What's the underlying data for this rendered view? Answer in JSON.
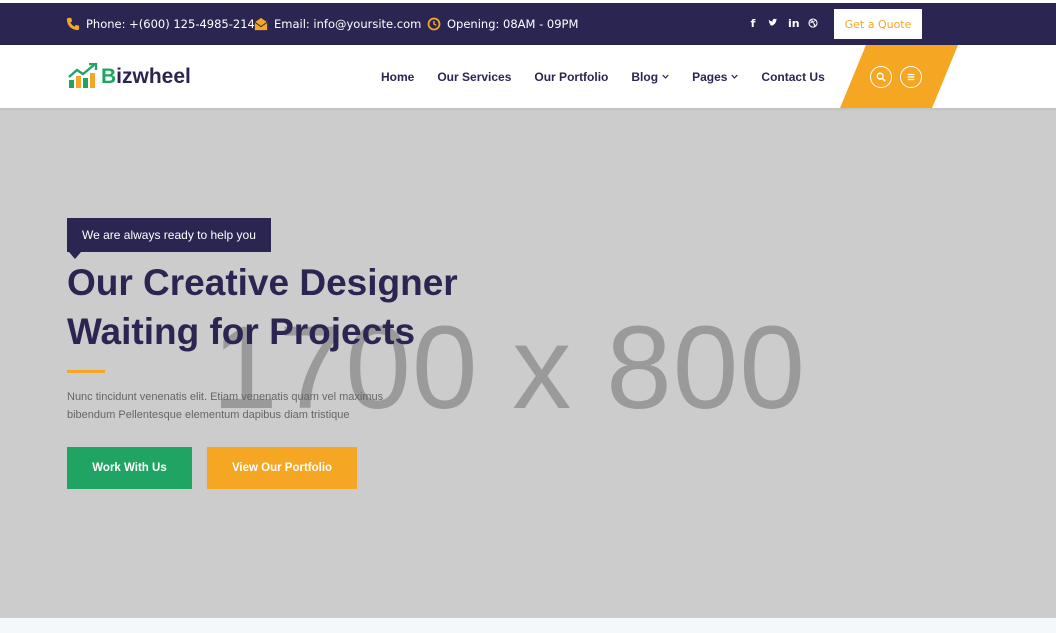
{
  "topbar": {
    "phone": "Phone: +(600) 125-4985-214",
    "email": "Email: info@yoursite.com",
    "hours": "Opening: 08AM - 09PM",
    "social_icons": [
      "facebook-icon",
      "twitter-icon",
      "linkedin-icon",
      "dribbble-icon"
    ],
    "quote_label": "Get a Quote"
  },
  "header": {
    "logo_prefix": "B",
    "logo_rest": "izwheel",
    "nav": [
      {
        "label": "Home"
      },
      {
        "label": "Our Services"
      },
      {
        "label": "Our Portfolio"
      },
      {
        "label": "Blog"
      },
      {
        "label": "Pages"
      },
      {
        "label": "Contact Us"
      }
    ]
  },
  "hero": {
    "placeholder": "1700 x 800",
    "tagline": "We are always ready to help you",
    "headline_line1": "Our Creative Designer",
    "headline_line2": "Waiting for Projects",
    "desc_line1": "Nunc tincidunt venenatis elit. Etiam venenatis quam vel maximus",
    "desc_line2": "bibendum Pellentesque elementum dapibus diam tristique",
    "btn_work": "Work With Us",
    "btn_portfolio": "View Our Portfolio"
  },
  "colors": {
    "navy": "#2b2552",
    "orange": "#f5a623",
    "green": "#1fa463",
    "hero_bg": "#cccccc"
  }
}
